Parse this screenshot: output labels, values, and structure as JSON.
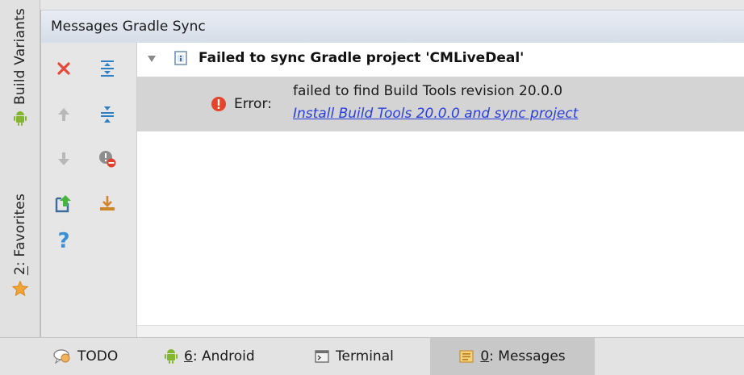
{
  "left_strip": {
    "build_variants_label": "Build Variants",
    "favorites_label_num": "2",
    "favorites_label_rest": ": Favorites"
  },
  "panel": {
    "title": "Messages Gradle Sync"
  },
  "toolbar": {
    "icons": [
      "close-icon",
      "expand-all-icon",
      "arrow-up-icon",
      "collapse-all-icon",
      "arrow-down-icon",
      "warnings-filter-icon",
      "export-icon",
      "autoscroll-icon",
      "help-icon"
    ]
  },
  "messages": {
    "group_title": "Failed to sync Gradle project 'CMLiveDeal'",
    "error_label": "Error:",
    "error_text": "failed to find Build Tools revision 20.0.0",
    "error_link": "Install Build Tools 20.0.0 and sync project"
  },
  "bottom_bar": {
    "tabs": [
      {
        "label": "TODO"
      },
      {
        "num": "6",
        "rest": ": Android"
      },
      {
        "label": "Terminal"
      },
      {
        "num": "0",
        "rest": ": Messages"
      }
    ]
  },
  "colors": {
    "link": "#2a3ed8",
    "error": "#e3462e",
    "android": "#84b72f",
    "star": "#f2a336"
  }
}
